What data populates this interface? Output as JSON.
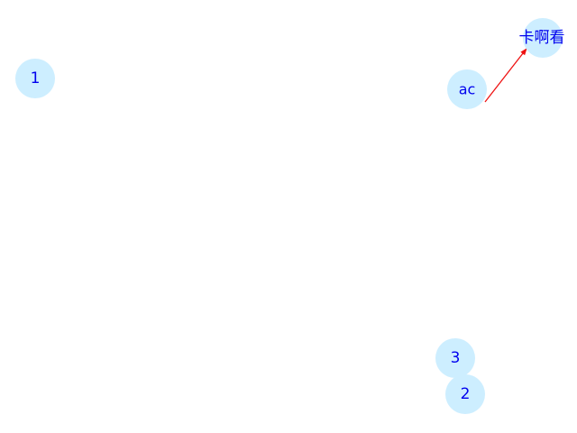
{
  "graph": {
    "colors": {
      "background": "#ffffff",
      "node_fill": "#cdeeff",
      "label_text": "#0000ee",
      "edge": "#ee1111"
    },
    "nodes": [
      {
        "id": "n1",
        "label": "1"
      },
      {
        "id": "nac",
        "label": "ac"
      },
      {
        "id": "nkak",
        "label": "卡啊看"
      },
      {
        "id": "n3",
        "label": "3"
      },
      {
        "id": "n2",
        "label": "2"
      }
    ],
    "edges": [
      {
        "from": "nac",
        "to": "nkak",
        "directed": true
      }
    ]
  }
}
